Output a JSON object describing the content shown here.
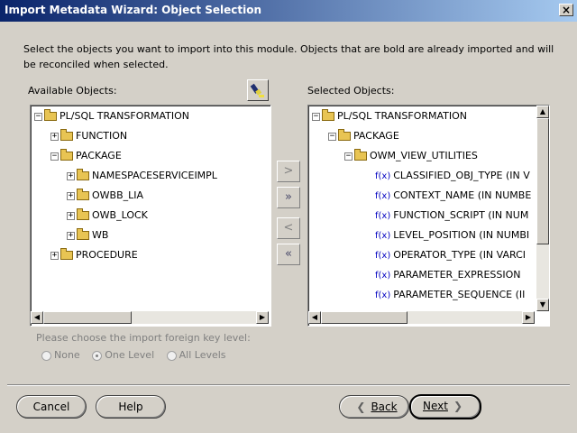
{
  "window": {
    "title": "Import Metadata Wizard: Object Selection",
    "close_glyph": "×"
  },
  "instructions": "Select the objects you want to import into this module. Objects that are bold are already imported and will be reconciled when selected.",
  "available": {
    "label": "Available Objects:",
    "highlight_icon": "highlighter-icon",
    "tree": [
      {
        "label": "PL/SQL TRANSFORMATION",
        "toggle": "−",
        "icon": "folder-icon"
      },
      {
        "label": "FUNCTION",
        "toggle": "+",
        "icon": "folder-icon"
      },
      {
        "label": "PACKAGE",
        "toggle": "−",
        "icon": "folder-icon"
      },
      {
        "label": "NAMESPACESERVICEIMPL",
        "toggle": "+",
        "icon": "folder-icon"
      },
      {
        "label": "OWBB_LIA",
        "toggle": "+",
        "icon": "folder-icon"
      },
      {
        "label": "OWB_LOCK",
        "toggle": "+",
        "icon": "folder-icon"
      },
      {
        "label": "WB",
        "toggle": "+",
        "icon": "folder-icon"
      },
      {
        "label": "PROCEDURE",
        "toggle": "+",
        "icon": "folder-icon"
      }
    ]
  },
  "selected": {
    "label": "Selected Objects:",
    "tree": [
      {
        "label": "PL/SQL TRANSFORMATION",
        "toggle": "−",
        "icon": "folder-icon"
      },
      {
        "label": "PACKAGE",
        "toggle": "−",
        "icon": "folder-icon"
      },
      {
        "label": "OWM_VIEW_UTILITIES",
        "toggle": "−",
        "icon": "folder-icon"
      },
      {
        "label": "CLASSIFIED_OBJ_TYPE (IN V",
        "prefix": "f(x)"
      },
      {
        "label": "CONTEXT_NAME (IN NUMBE",
        "prefix": "f(x)"
      },
      {
        "label": "FUNCTION_SCRIPT (IN NUM",
        "prefix": "f(x)"
      },
      {
        "label": "LEVEL_POSITION (IN NUMBI",
        "prefix": "f(x)"
      },
      {
        "label": "OPERATOR_TYPE (IN VARCI",
        "prefix": "f(x)"
      },
      {
        "label": "PARAMETER_EXPRESSION",
        "prefix": "f(x)"
      },
      {
        "label": "PARAMETER_SEQUENCE (II",
        "prefix": "f(x)"
      }
    ]
  },
  "move_buttons": [
    {
      "glyph": ">",
      "name": "move-right-button"
    },
    {
      "glyph": "»",
      "name": "move-all-right-button"
    },
    {
      "glyph": "<",
      "name": "move-left-button"
    },
    {
      "glyph": "«",
      "name": "move-all-left-button"
    }
  ],
  "foreign_key": {
    "prompt": "Please choose the import foreign key level:",
    "options": [
      "None",
      "One Level",
      "All Levels"
    ],
    "selected": "One Level"
  },
  "buttons": {
    "cancel": "Cancel",
    "help": "Help",
    "back": "Back",
    "next": "Next",
    "back_chevron": "❮",
    "next_chevron": "❯"
  }
}
